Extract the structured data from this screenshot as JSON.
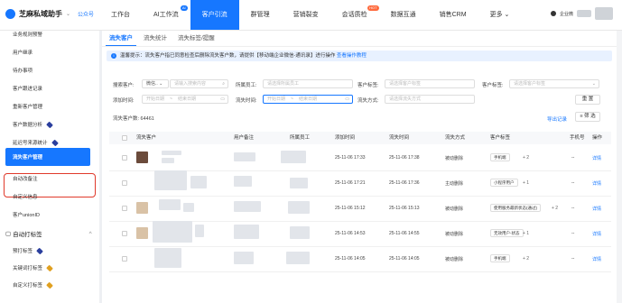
{
  "topbar": {
    "brand": "芝麻私域助手",
    "account_tag": "公众号",
    "nav": [
      {
        "label": "工作台",
        "badge": ""
      },
      {
        "label": "AI工作流",
        "badge": "AI"
      },
      {
        "label": "客户引流",
        "badge": ""
      },
      {
        "label": "群管理",
        "badge": ""
      },
      {
        "label": "营销裂变",
        "badge": ""
      },
      {
        "label": "会话质检",
        "badge": "HOT"
      },
      {
        "label": "数据互通",
        "badge": ""
      },
      {
        "label": "销售CRM",
        "badge": ""
      },
      {
        "label": "更多 ⌄",
        "badge": ""
      }
    ],
    "active_index": 2,
    "user_label": "企业微",
    "accent": "#1677ff"
  },
  "sidebar": {
    "items": [
      {
        "label": "业务规则预警",
        "gem": ""
      },
      {
        "label": "用户继承",
        "gem": ""
      },
      {
        "label": "待办事项",
        "gem": ""
      },
      {
        "label": "客户跟进记录",
        "gem": ""
      },
      {
        "label": "重新客户管理",
        "gem": ""
      },
      {
        "label": "客户数据分析",
        "gem": "blue"
      },
      {
        "label": "延迟号来源统计",
        "gem": "blue"
      },
      {
        "label": "流失客户管理",
        "gem": ""
      },
      {
        "label": "自动改备注",
        "gem": ""
      },
      {
        "label": "自定义信息",
        "gem": ""
      },
      {
        "label": "客户unionID",
        "gem": ""
      },
      {
        "label": "自动打标签",
        "gem": ""
      },
      {
        "label": "预打标签",
        "gem": "blue"
      },
      {
        "label": "关键词打标签",
        "gem": "gold"
      },
      {
        "label": "自定义打标签",
        "gem": "gold"
      }
    ]
  },
  "tabs": [
    "流失客户",
    "流失统计",
    "流失标签/提醒"
  ],
  "notice": {
    "text": "温馨提示：流失客户指已同意检查后删除流失客户数，请提供【移动端企业微信-通讯录】进行操作",
    "link": "查看操作教程"
  },
  "filters": {
    "search_customer_label": "搜索客户:",
    "search_type": "微信..",
    "search_placeholder": "请输入搜索内容",
    "staff_label": "所属员工:",
    "staff_placeholder": "请选择所属员工",
    "customer_tag_label": "客户标签:",
    "customer_tag_placeholder": "请选择客户标签",
    "client_tag_label": "客户标签:",
    "client_tag_placeholder": "请选择客户标签",
    "add_time_label": "添加时间:",
    "lost_time_label": "流失时间:",
    "lost_method_label": "流失方式:",
    "lost_method_placeholder": "请选择流失方式",
    "start_date": "开始日期",
    "end_date": "结束日期",
    "to": "~",
    "reset_label": "重 置",
    "search_label": "筛 选"
  },
  "count_label": "流失客户数: 64461",
  "export_label": "导出记录",
  "table": {
    "headers": [
      "流失客户",
      "用户备注",
      "所属员工",
      "添加时间",
      "流失时间",
      "流失方式",
      "客户标签",
      "手机号",
      "操作"
    ],
    "rows": [
      {
        "add_time": "25-11-06 17:33",
        "lost_time": "25-11-06 17:38",
        "method": "被动删除",
        "tag": "手机端",
        "extra": "+ 2",
        "phone": "--",
        "action": "详情"
      },
      {
        "add_time": "25-11-06 17:21",
        "lost_time": "25-11-06 17:36",
        "method": "主动删除",
        "tag": "小程序用户",
        "extra": "+ 1",
        "phone": "--",
        "action": "详情"
      },
      {
        "add_time": "25-11-06 15:12",
        "lost_time": "25-11-06 15:13",
        "method": "被动删除",
        "tag": "使用服务最新状态(通过)",
        "extra": "+ 2",
        "phone": "--",
        "action": "详情"
      },
      {
        "add_time": "25-11-06 14:53",
        "lost_time": "25-11-06 14:55",
        "method": "被动删除",
        "tag": "无效用户-状态",
        "extra": "+ 1",
        "phone": "--",
        "action": "详情"
      },
      {
        "add_time": "25-11-06 14:05",
        "lost_time": "25-11-06 14:05",
        "method": "被动删除",
        "tag": "手机端",
        "extra": "+ 2",
        "phone": "--",
        "action": "详情"
      }
    ]
  }
}
